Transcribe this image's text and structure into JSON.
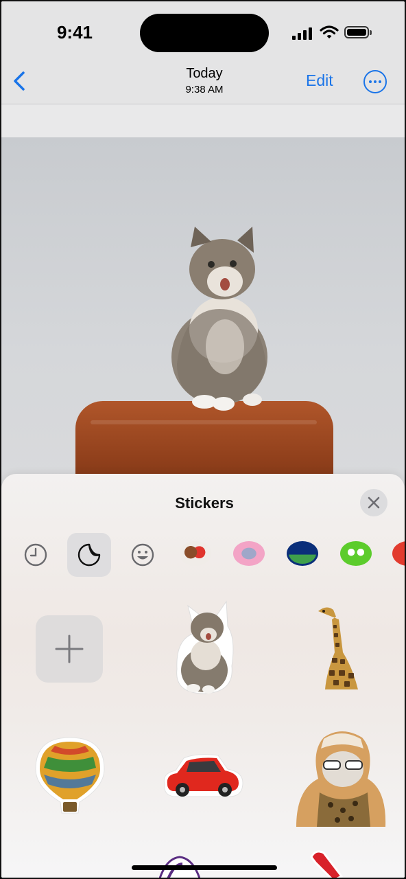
{
  "status": {
    "time": "9:41"
  },
  "nav": {
    "title": "Today",
    "subtitle": "9:38 AM",
    "edit_label": "Edit"
  },
  "photo": {
    "subject": "kitten on leather chair"
  },
  "stickers": {
    "title": "Stickers",
    "tabs": [
      {
        "icon": "recents-clock-icon",
        "selected": false
      },
      {
        "icon": "sticker-peel-icon",
        "selected": true
      },
      {
        "icon": "emoji-smiley-icon",
        "selected": false
      },
      {
        "icon": "memoji-pack-icon",
        "selected": false
      },
      {
        "icon": "alien-pack-icon",
        "selected": false
      },
      {
        "icon": "landscape-pack-icon",
        "selected": false
      },
      {
        "icon": "owl-pack-icon",
        "selected": false
      },
      {
        "icon": "red-pack-icon",
        "selected": false
      }
    ],
    "items": [
      "add-sticker",
      "kitten-sticker",
      "giraffe-sticker",
      "balloon-sticker",
      "red-car-sticker",
      "cat-sunglasses-sticker"
    ]
  },
  "colors": {
    "accent": "#1a74e8"
  }
}
